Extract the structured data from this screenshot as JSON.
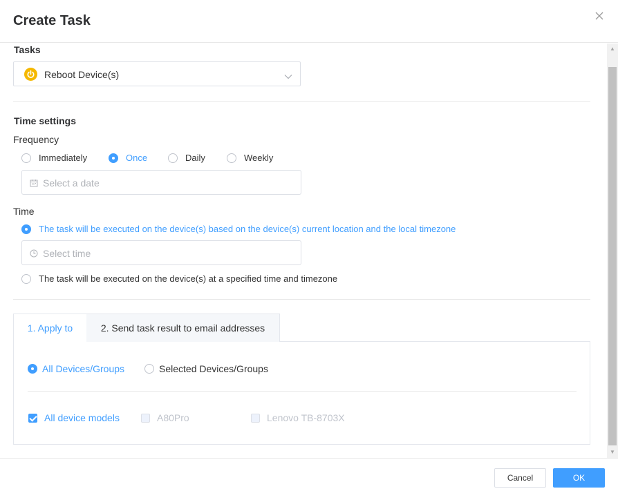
{
  "dialog": {
    "title": "Create Task"
  },
  "tasks": {
    "heading": "Tasks",
    "selected": "Reboot Device(s)"
  },
  "time_settings": {
    "heading": "Time settings",
    "frequency_label": "Frequency",
    "frequency_options": [
      "Immediately",
      "Once",
      "Daily",
      "Weekly"
    ],
    "frequency_selected": "Once",
    "date_placeholder": "Select a date",
    "time_label": "Time",
    "time_option_local": "The task will be executed on the device(s) based on the device(s) current location and the local timezone",
    "time_placeholder": "Select time",
    "time_option_specified": "The task will be executed on the device(s) at a specified time and timezone"
  },
  "tabs": [
    {
      "label": "1. Apply to",
      "active": true
    },
    {
      "label": "2. Send task result to email addresses",
      "active": false
    }
  ],
  "apply_to": {
    "scope_options": [
      "All Devices/Groups",
      "Selected Devices/Groups"
    ],
    "scope_selected": "All Devices/Groups",
    "models": [
      {
        "label": "All device models",
        "checked": true,
        "disabled": false
      },
      {
        "label": "A80Pro",
        "checked": false,
        "disabled": true
      },
      {
        "label": "Lenovo TB-8703X",
        "checked": false,
        "disabled": true
      }
    ]
  },
  "footer": {
    "cancel_label": "Cancel",
    "ok_label": "OK"
  },
  "colors": {
    "accent": "#409eff",
    "power_icon": "#f5b800"
  }
}
